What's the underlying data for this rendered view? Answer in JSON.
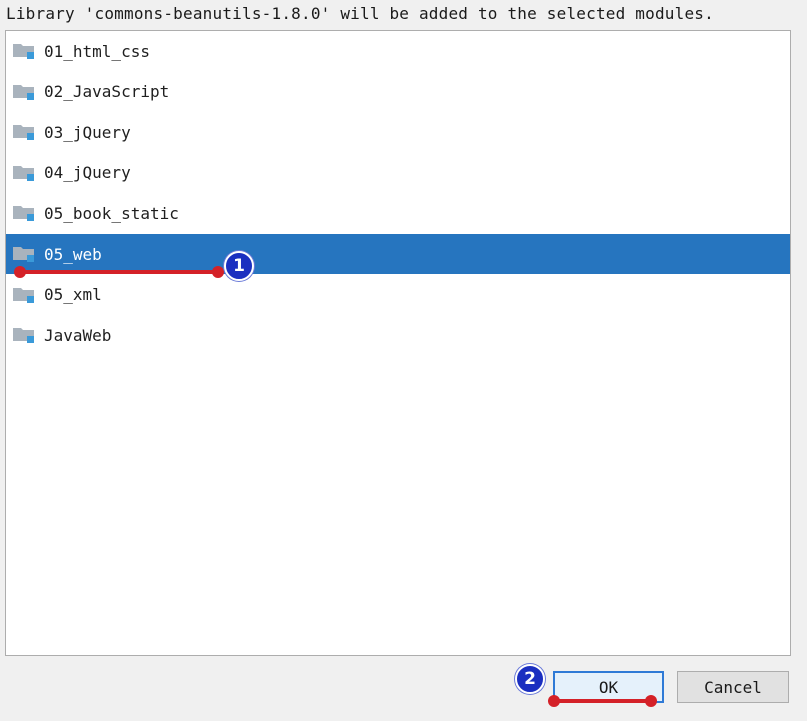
{
  "dialog": {
    "message": "Library 'commons-beanutils-1.8.0' will be added to the selected modules."
  },
  "modules": [
    {
      "name": "01_html_css",
      "selected": false
    },
    {
      "name": "02_JavaScript",
      "selected": false
    },
    {
      "name": "03_jQuery",
      "selected": false
    },
    {
      "name": "04_jQuery",
      "selected": false
    },
    {
      "name": "05_book_static",
      "selected": false
    },
    {
      "name": "05_web",
      "selected": true
    },
    {
      "name": "05_xml",
      "selected": false
    },
    {
      "name": "JavaWeb",
      "selected": false
    }
  ],
  "buttons": {
    "ok_label": "OK",
    "cancel_label": "Cancel"
  },
  "annotations": {
    "step1": "1",
    "step2": "2"
  },
  "colors": {
    "selection": "#2675bf",
    "annotation_line": "#d42128",
    "annotation_badge": "#1b2fc0",
    "folder_gray": "#a9b3bd",
    "module_badge": "#3a9ad9"
  },
  "icons": {
    "module_icon": "module-folder-icon"
  }
}
